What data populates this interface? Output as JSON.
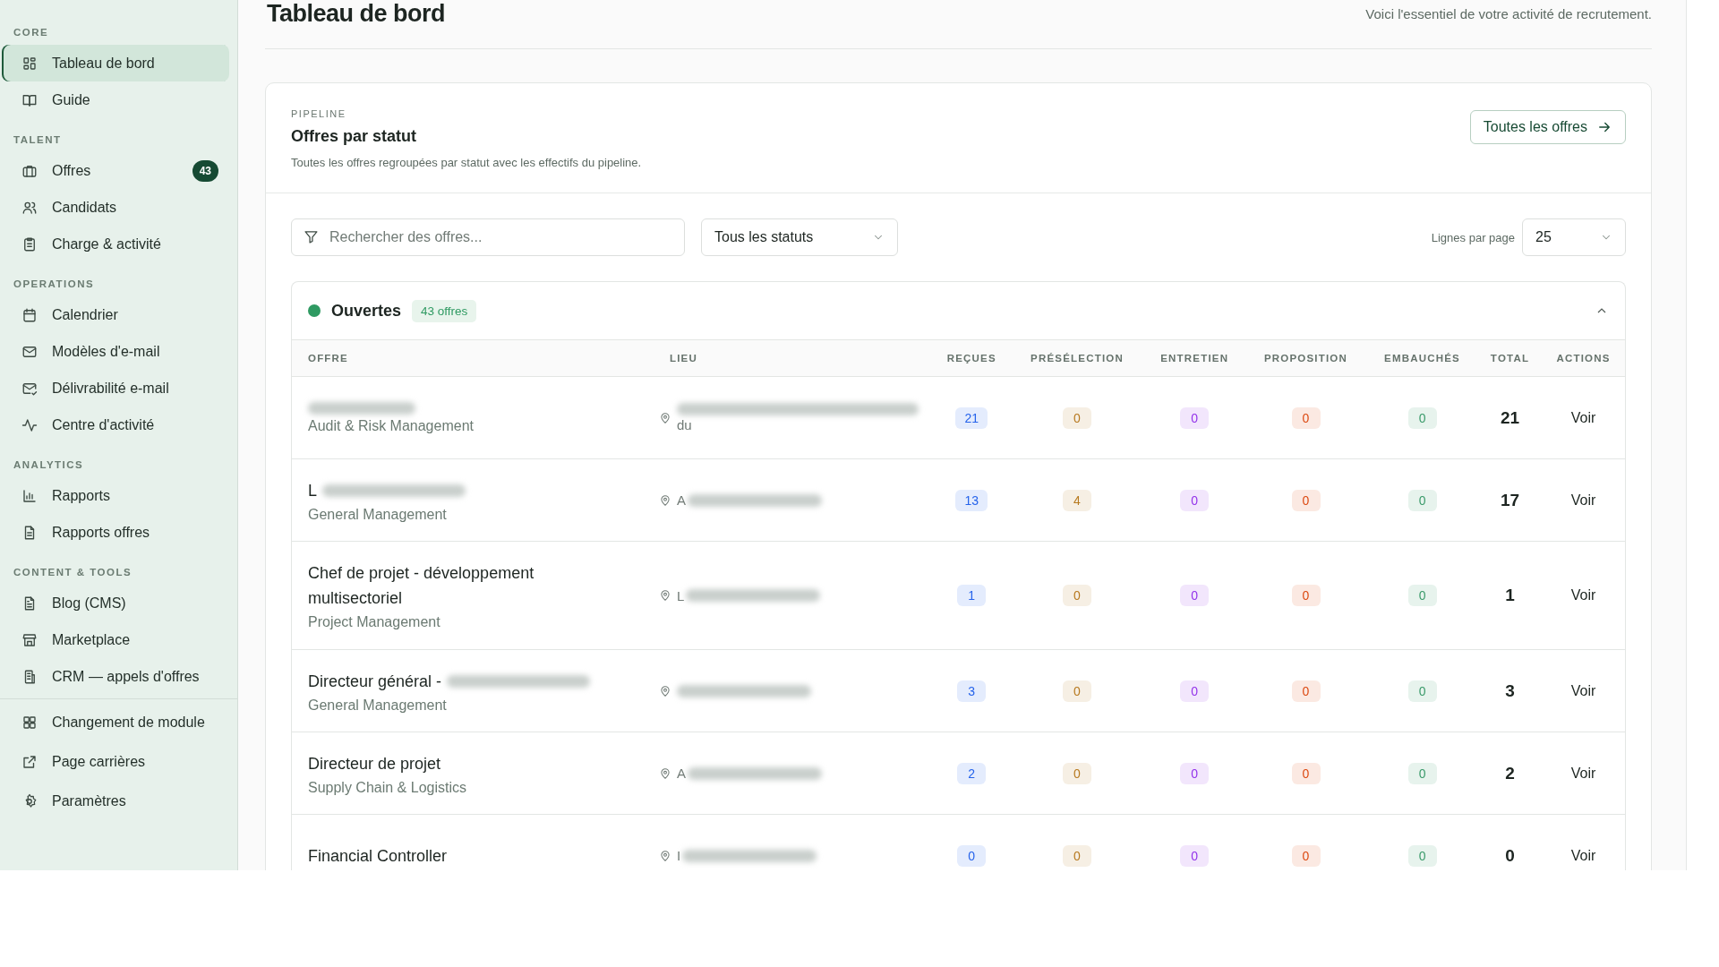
{
  "sidebar": {
    "sections": [
      {
        "label": "CORE",
        "items": [
          {
            "label": "Tableau de bord",
            "selected": true
          },
          {
            "label": "Guide",
            "selected": false
          }
        ]
      },
      {
        "label": "TALENT",
        "items": [
          {
            "label": "Offres",
            "selected": false,
            "badge": "43"
          },
          {
            "label": "Candidats",
            "selected": false
          },
          {
            "label": "Charge & activité",
            "selected": false
          }
        ]
      },
      {
        "label": "OPERATIONS",
        "items": [
          {
            "label": "Calendrier",
            "selected": false
          },
          {
            "label": "Modèles d'e-mail",
            "selected": false
          },
          {
            "label": "Délivrabilité e-mail",
            "selected": false
          },
          {
            "label": "Centre d'activité",
            "selected": false
          }
        ]
      },
      {
        "label": "ANALYTICS",
        "items": [
          {
            "label": "Rapports",
            "selected": false
          },
          {
            "label": "Rapports offres",
            "selected": false
          }
        ]
      },
      {
        "label": "CONTENT & TOOLS",
        "items": [
          {
            "label": "Blog (CMS)",
            "selected": false
          },
          {
            "label": "Marketplace",
            "selected": false
          },
          {
            "label": "CRM — appels d'offres",
            "selected": false
          }
        ]
      }
    ],
    "footer_items": [
      {
        "label": "Changement de module"
      },
      {
        "label": "Page carrières"
      },
      {
        "label": "Paramètres"
      }
    ]
  },
  "header": {
    "title": "Tableau de bord",
    "subtitle": "Voici l'essentiel de votre activité de recrutement."
  },
  "pipeline": {
    "eyebrow": "PIPELINE",
    "title": "Offres par statut",
    "description": "Toutes les offres regroupées par statut avec les effectifs du pipeline.",
    "all_button": "Toutes les offres",
    "search": {
      "placeholder": "Rechercher des offres..."
    },
    "status_filter": "Tous les statuts",
    "rows_per_page_label": "Lignes par page",
    "rows_per_page": "25",
    "group": {
      "name": "Ouvertes",
      "color": "#2f9a62",
      "count": "43 offres",
      "expanded": true,
      "columns": [
        {
          "label": "OFFRE",
          "kind": "offer"
        },
        {
          "label": "LIEU",
          "kind": "location"
        },
        {
          "label": "REÇUES",
          "kind": "count",
          "color": "#2563eb"
        },
        {
          "label": "PRÉSÉLECTION",
          "kind": "count",
          "color": "#b7791f"
        },
        {
          "label": "ENTRETIEN",
          "kind": "count",
          "color": "#9333ea"
        },
        {
          "label": "PROPOSITION",
          "kind": "count",
          "color": "#dc4a12"
        },
        {
          "label": "EMBAUCHÉS",
          "kind": "count",
          "color": "#3a9a6a"
        },
        {
          "label": "TOTAL",
          "kind": "total"
        },
        {
          "label": "ACTIONS",
          "kind": "action"
        }
      ],
      "rows": [
        {
          "title_blurred": true,
          "category": "Audit & Risk Management",
          "location": "du",
          "location_blurred": true,
          "location_blur_first": true,
          "counts": [
            "21",
            "0",
            "0",
            "0",
            "0"
          ],
          "total": "21",
          "action": "Voir"
        },
        {
          "title": "L",
          "title_blurred": true,
          "category": "General Management",
          "location": "A",
          "location_blurred": true,
          "location_blur_first": false,
          "counts": [
            "13",
            "4",
            "0",
            "0",
            "0"
          ],
          "total": "17",
          "action": "Voir"
        },
        {
          "title": "Chef de projet - développement multisectoriel",
          "title_blurred": false,
          "category": "Project Management",
          "location": "L",
          "location_blurred": true,
          "location_blur_first": false,
          "counts": [
            "1",
            "0",
            "0",
            "0",
            "0"
          ],
          "total": "1",
          "action": "Voir"
        },
        {
          "title": "Directeur général -",
          "title_blurred": true,
          "category": "General Management",
          "location_blurred": true,
          "location_blur_first": false,
          "counts": [
            "3",
            "0",
            "0",
            "0",
            "0"
          ],
          "total": "3",
          "action": "Voir"
        },
        {
          "title": "Directeur de projet",
          "title_blurred": false,
          "category": "Supply Chain & Logistics",
          "location": "A",
          "location_blurred": true,
          "location_blur_first": false,
          "counts": [
            "2",
            "0",
            "0",
            "0",
            "0"
          ],
          "total": "2",
          "action": "Voir"
        },
        {
          "title": "Financial Controller",
          "title_blurred": false,
          "location": "I",
          "location_blurred": true,
          "location_blur_first": false,
          "counts": [
            "0",
            "0",
            "0",
            "0",
            "0"
          ],
          "total": "0",
          "action": "Voir"
        }
      ]
    }
  }
}
